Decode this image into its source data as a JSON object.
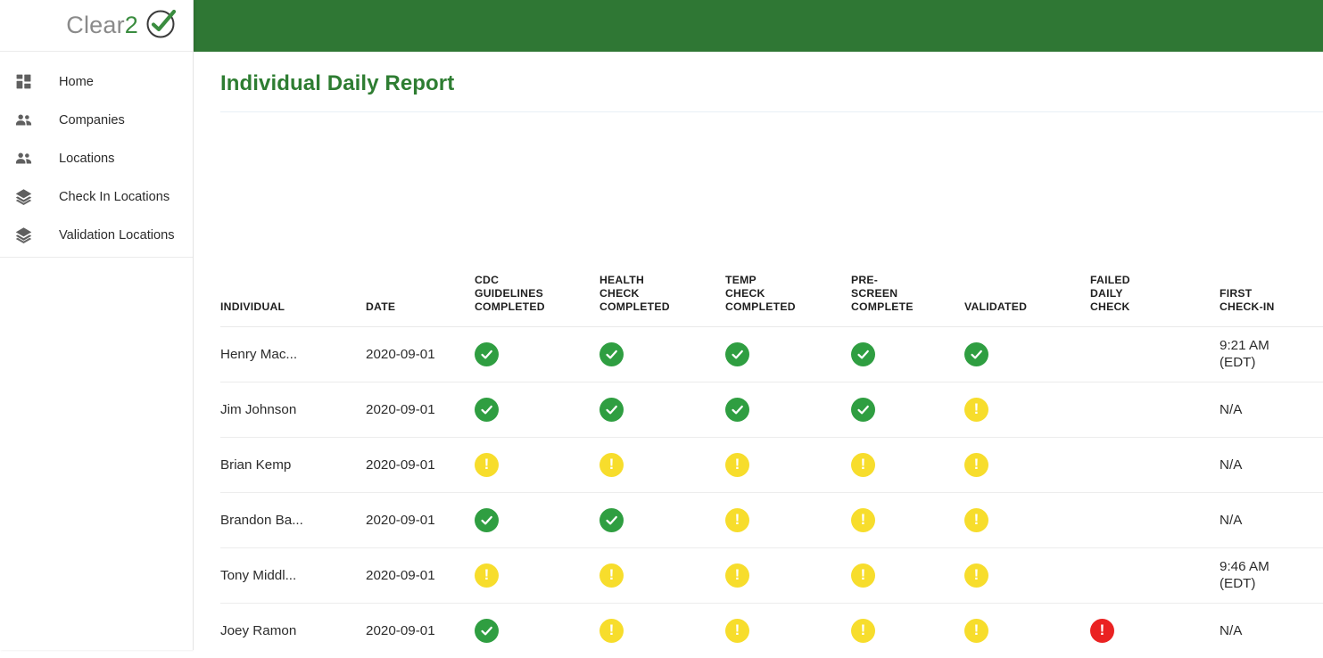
{
  "brand": {
    "name_main": "Clear",
    "name_num": "2",
    "mark_icon": "circled-check-icon"
  },
  "colors": {
    "brand_green": "#2f7734",
    "title_green": "#2e7d32",
    "status_ok": "#2f9e41",
    "status_warn": "#f7dd2c",
    "status_fail": "#ea2222"
  },
  "sidebar": {
    "items": [
      {
        "label": "Home",
        "icon": "dashboard-icon"
      },
      {
        "label": "Companies",
        "icon": "people-icon"
      },
      {
        "label": "Locations",
        "icon": "people-icon"
      },
      {
        "label": "Check In Locations",
        "icon": "layers-icon"
      },
      {
        "label": "Validation Locations",
        "icon": "layers-icon"
      }
    ]
  },
  "main": {
    "title": "Individual Daily Report"
  },
  "table": {
    "columns": [
      {
        "key": "individual",
        "lines": [
          "INDIVIDUAL"
        ]
      },
      {
        "key": "date",
        "lines": [
          "DATE"
        ]
      },
      {
        "key": "cdc",
        "lines": [
          "CDC",
          "GUIDELINES",
          "COMPLETED"
        ]
      },
      {
        "key": "health",
        "lines": [
          "HEALTH",
          "CHECK",
          "COMPLETED"
        ]
      },
      {
        "key": "temp",
        "lines": [
          "TEMP",
          "CHECK",
          "COMPLETED"
        ]
      },
      {
        "key": "pre",
        "lines": [
          "PRE-",
          "SCREEN",
          "COMPLETE"
        ]
      },
      {
        "key": "validated",
        "lines": [
          "VALIDATED"
        ]
      },
      {
        "key": "failed",
        "lines": [
          "FAILED",
          "DAILY",
          "CHECK"
        ]
      },
      {
        "key": "first",
        "lines": [
          "FIRST",
          "CHECK-IN"
        ]
      }
    ],
    "rows": [
      {
        "individual": "Henry Mac...",
        "date": "2020-09-01",
        "cdc": "ok",
        "health": "ok",
        "temp": "ok",
        "pre": "ok",
        "validated": "ok",
        "failed": "none",
        "first": "9:21 AM\n(EDT)"
      },
      {
        "individual": "Jim Johnson",
        "date": "2020-09-01",
        "cdc": "ok",
        "health": "ok",
        "temp": "ok",
        "pre": "ok",
        "validated": "warn",
        "failed": "none",
        "first": "N/A"
      },
      {
        "individual": "Brian Kemp",
        "date": "2020-09-01",
        "cdc": "warn",
        "health": "warn",
        "temp": "warn",
        "pre": "warn",
        "validated": "warn",
        "failed": "none",
        "first": "N/A"
      },
      {
        "individual": "Brandon Ba...",
        "date": "2020-09-01",
        "cdc": "ok",
        "health": "ok",
        "temp": "warn",
        "pre": "warn",
        "validated": "warn",
        "failed": "none",
        "first": "N/A"
      },
      {
        "individual": "Tony Middl...",
        "date": "2020-09-01",
        "cdc": "warn",
        "health": "warn",
        "temp": "warn",
        "pre": "warn",
        "validated": "warn",
        "failed": "none",
        "first": "9:46 AM\n(EDT)"
      },
      {
        "individual": "Joey Ramon",
        "date": "2020-09-01",
        "cdc": "ok",
        "health": "warn",
        "temp": "warn",
        "pre": "warn",
        "validated": "warn",
        "failed": "fail",
        "first": "N/A"
      }
    ]
  }
}
